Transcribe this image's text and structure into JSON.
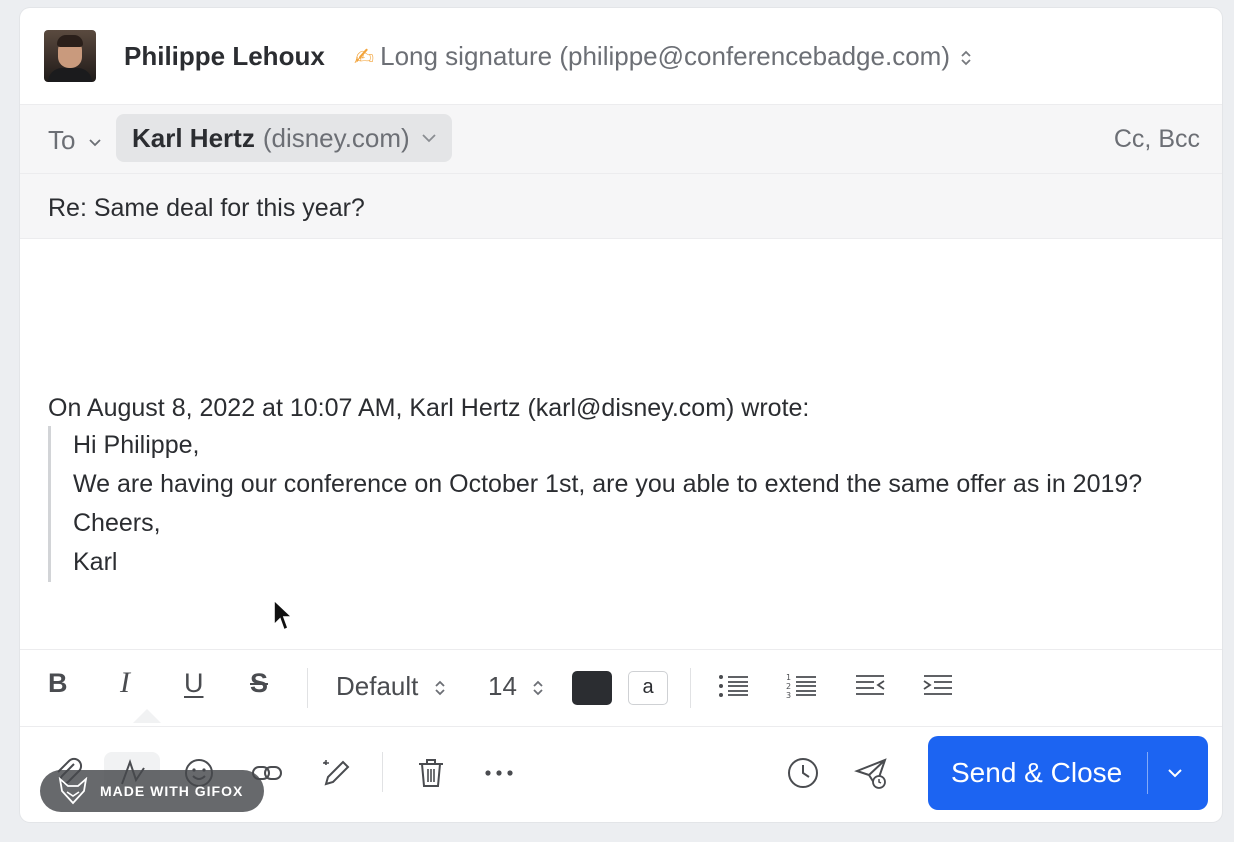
{
  "from": {
    "name": "Philippe Lehoux",
    "signature_icon": "✍",
    "signature": "Long signature (philippe@conferencebadge.com)",
    "selector_icon": "⌃⌄"
  },
  "recipients": {
    "to_label": "To",
    "chip_name": "Karl Hertz",
    "chip_domain": "(disney.com)",
    "cc_bcc": "Cc, Bcc"
  },
  "subject": "Re: Same deal for this year?",
  "quoted": {
    "intro": "On August 8, 2022 at 10:07 AM, Karl Hertz (karl@disney.com) wrote:",
    "lines": [
      "Hi Philippe,",
      "We are having our conference on October 1st, are you able to extend the same offer as in 2019?",
      "Cheers,",
      "Karl"
    ]
  },
  "format_toolbar": {
    "bold": "B",
    "italic": "I",
    "underline": "U",
    "strike": "S",
    "font": "Default",
    "size": "14",
    "bg_letter": "a",
    "text_color": "#2b2d31"
  },
  "actions": {
    "send_label": "Send & Close",
    "send_color": "#1c64f2"
  },
  "watermark": "MADE WITH GIFOX"
}
